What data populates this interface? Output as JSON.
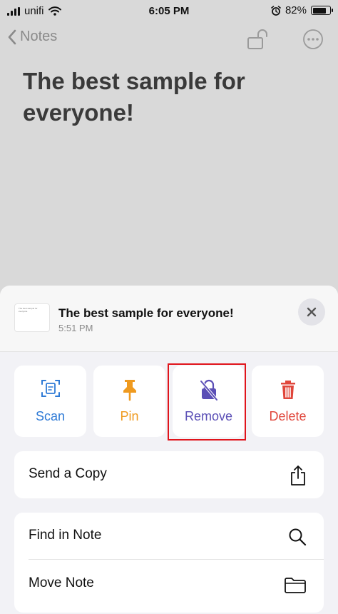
{
  "status": {
    "carrier": "unifi",
    "time": "6:05 PM",
    "battery": "82%",
    "battery_level": 0.82
  },
  "nav": {
    "back_label": "Notes"
  },
  "note": {
    "title": "The best sample for everyone!",
    "thumb_text": "The best sample for everyone",
    "time": "5:51 PM"
  },
  "actions": [
    {
      "label": "Scan",
      "color": "#2e7ad6"
    },
    {
      "label": "Pin",
      "color": "#ef9a1f"
    },
    {
      "label": "Remove",
      "color": "#5b4fb6"
    },
    {
      "label": "Delete",
      "color": "#e0463b"
    }
  ],
  "menu": {
    "send_copy": "Send a Copy",
    "find_in_note": "Find in Note",
    "move_note": "Move Note"
  },
  "icons": {
    "status": [
      "signal-icon",
      "wifi-icon",
      "alarm-icon",
      "battery-icon"
    ],
    "nav": [
      "chevron-left-icon",
      "unlock-icon",
      "more-icon"
    ],
    "actions": [
      "scan-icon",
      "pin-icon",
      "remove-lock-icon",
      "trash-icon"
    ],
    "menu": [
      "share-icon",
      "search-icon",
      "folder-icon"
    ]
  }
}
